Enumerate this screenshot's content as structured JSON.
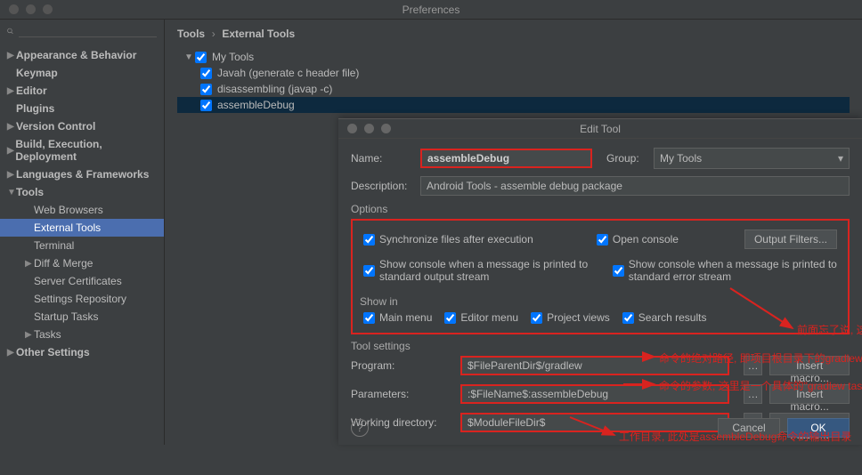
{
  "window": {
    "title": "Preferences"
  },
  "sidebar": {
    "items": [
      {
        "label": "Appearance & Behavior",
        "expandable": true
      },
      {
        "label": "Keymap"
      },
      {
        "label": "Editor",
        "expandable": true
      },
      {
        "label": "Plugins"
      },
      {
        "label": "Version Control",
        "expandable": true
      },
      {
        "label": "Build, Execution, Deployment",
        "expandable": true
      },
      {
        "label": "Languages & Frameworks",
        "expandable": true
      },
      {
        "label": "Tools",
        "expandable": true,
        "expanded": true,
        "children": [
          {
            "label": "Web Browsers"
          },
          {
            "label": "External Tools",
            "selected": true
          },
          {
            "label": "Terminal"
          },
          {
            "label": "Diff & Merge",
            "expandable": true
          },
          {
            "label": "Server Certificates"
          },
          {
            "label": "Settings Repository"
          },
          {
            "label": "Startup Tasks"
          },
          {
            "label": "Tasks",
            "expandable": true
          }
        ]
      },
      {
        "label": "Other Settings",
        "expandable": true
      }
    ]
  },
  "breadcrumb": {
    "root": "Tools",
    "leaf": "External Tools"
  },
  "toolList": {
    "group": "My Tools",
    "items": [
      {
        "label": "Javah (generate c header file)"
      },
      {
        "label": "disassembling (javap -c)"
      },
      {
        "label": "assembleDebug",
        "selected": true
      }
    ]
  },
  "dialog": {
    "title": "Edit Tool",
    "nameLabel": "Name:",
    "nameValue": "assembleDebug",
    "groupLabel": "Group:",
    "groupValue": "My Tools",
    "descLabel": "Description:",
    "descValue": "Android Tools - assemble debug package",
    "optionsLabel": "Options",
    "checks": {
      "sync": "Synchronize files after execution",
      "openConsole": "Open console",
      "stdoutConsole": "Show console when a message is printed to standard output stream",
      "stderrConsole": "Show console when a message is printed to standard error stream"
    },
    "outputFiltersBtn": "Output Filters...",
    "showInLabel": "Show in",
    "showIn": {
      "mainMenu": "Main menu",
      "editorMenu": "Editor menu",
      "projectViews": "Project views",
      "searchResults": "Search results"
    },
    "toolSettingsLabel": "Tool settings",
    "programLabel": "Program:",
    "programValue": "$FileParentDir$/gradlew",
    "paramsLabel": "Parameters:",
    "paramsValue": ":$FileName$:assembleDebug",
    "workdirLabel": "Working directory:",
    "workdirValue": "$ModuleFileDir$",
    "insertMacroBtn": "Insert macro...",
    "cancelBtn": "Cancel",
    "okBtn": "OK"
  },
  "annotations": {
    "allChecked": "前面忘了说, 这些选项最好全勾上",
    "program": "命令的绝对路径, 即项目根目录下的gradlew",
    "params": "命令的参数, 这里是一个具体的\"gradlew task\" — assembleDebug",
    "workdir": "工作目录, 此处是assembleDebug命令的输出目录"
  }
}
